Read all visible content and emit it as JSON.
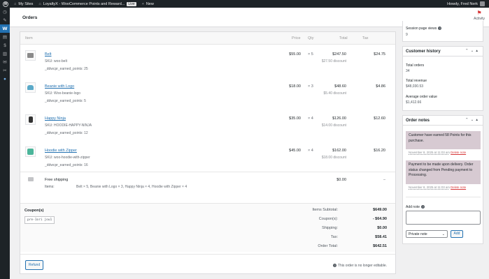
{
  "adminbar": {
    "my_sites": "My Sites",
    "site_name": "LoyaltyX - WooCommerce Points and Reward...",
    "live_badge": "Live",
    "new_label": "New",
    "howdy": "Howdy, Fred Nerk"
  },
  "header": {
    "title": "Orders",
    "activity_label": "Activity"
  },
  "table": {
    "col_item": "Item",
    "col_price": "Price",
    "col_qty": "Qty",
    "col_total": "Total",
    "col_tax": "Tax"
  },
  "items": [
    {
      "name": "Belt",
      "sku": "SKU: woo-belt",
      "meta": "_ddwcpr_earned_points: 25",
      "price": "$55.00",
      "qty": "× 5",
      "total": "$247.50",
      "discount": "$27.50 discount",
      "tax": "$24.75",
      "thumb_color": "#8a8a8a"
    },
    {
      "name": "Beanie with Logo",
      "sku": "SKU: Woo-beanie-logo",
      "meta": "_ddwcpr_earned_points: 5",
      "price": "$18.00",
      "qty": "× 3",
      "total": "$48.60",
      "discount": "$5.40 discount",
      "tax": "$4.86",
      "thumb_color": "#5aa9c8"
    },
    {
      "name": "Happy Ninja",
      "sku": "SKU: HOODIE-HAPPY-NINJA",
      "meta": "_ddwcpr_earned_points: 12",
      "price": "$35.00",
      "qty": "× 4",
      "total": "$126.00",
      "discount": "$14.00 discount",
      "tax": "$12.60",
      "thumb_color": "#333333"
    },
    {
      "name": "Hoodie with Zipper",
      "sku": "SKU: woo-hoodie-with-zipper",
      "meta": "_ddwcpr_earned_points: 16",
      "price": "$45.00",
      "qty": "× 4",
      "total": "$162.00",
      "discount": "$18.00 discount",
      "tax": "$16.20",
      "thumb_color": "#4bb59a"
    }
  ],
  "shipping": {
    "name": "Free shipping",
    "items_label": "Items:",
    "items_value": "Belt × 5, Beanie with Logo × 3, Happy Ninja × 4, Hoodie with Zipper × 4",
    "total": "$0.00",
    "tax": "–"
  },
  "coupons": {
    "title": "Coupon(s)",
    "code": "pre-1ori jou1"
  },
  "totals": [
    {
      "label": "Items Subtotal:",
      "value": "$649.00"
    },
    {
      "label": "Coupon(s):",
      "value": "- $64.90"
    },
    {
      "label": "Shipping:",
      "value": "$0.00"
    },
    {
      "label": "Tax:",
      "value": "$58.41"
    },
    {
      "label": "Order Total:",
      "value": "$642.51"
    }
  ],
  "refund": {
    "button": "Refund",
    "not_editable": "This order is no longer editable."
  },
  "session": {
    "label": "Session page views",
    "value": "9"
  },
  "customer_history": {
    "title": "Customer history",
    "total_orders_label": "Total orders",
    "total_orders_value": "34",
    "total_revenue_label": "Total revenue",
    "total_revenue_value": "$48,030.53",
    "avg_order_label": "Average order value",
    "avg_order_value": "$1,412.66"
  },
  "order_notes": {
    "title": "Order notes",
    "notes": [
      {
        "text": "Customer have earned 58 Points for this purchase.",
        "date": "November 8, 2025 at 11:03 am",
        "delete": "Delete note"
      },
      {
        "text": "Payment to be made upon delivery. Order status changed from Pending payment to Processing.",
        "date": "November 8, 2025 at 11:03 am",
        "delete": "Delete note"
      }
    ],
    "add_note_label": "Add note",
    "note_type": "Private note",
    "add_button": "Add"
  },
  "colors": {
    "accent": "#2271b1",
    "note_bg": "#d7cad2",
    "admin_bar": "#1d2327"
  }
}
